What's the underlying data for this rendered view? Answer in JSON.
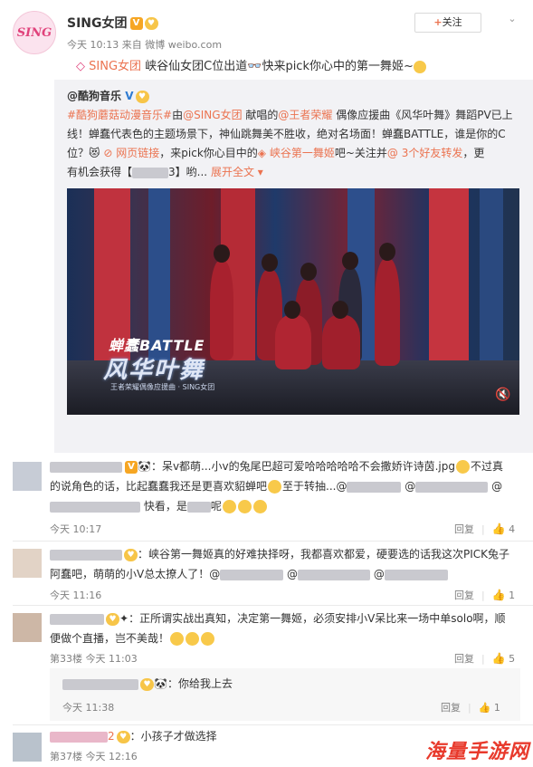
{
  "post": {
    "avatar_text": "SING",
    "username": "SING女团",
    "verified_badge": "V",
    "time": "今天 10:13",
    "source_prefix": "来自",
    "source": "微博 weibo.com",
    "follow_label": "关注",
    "follow_plus": "+",
    "mention": "SING女团",
    "text": "峡谷仙女团C位出道",
    "text2": "快来pick你心中的第一舞姬~"
  },
  "repost": {
    "author": "@酷狗音乐",
    "author_badge": "V",
    "line1_tag": "#酷狗蘑菇动漫音乐#",
    "line1_b": "由",
    "line1_c": "@SING女团",
    "line1_d": " 献唱的",
    "line1_e": "@王者荣耀",
    "line1_f": " 偶像应援曲《风华叶舞》舞蹈PV已上",
    "line2": "线！蝉蠢代表色的主题场景下，神仙跳舞美不胜收，绝对名场面！蝉蠢BATTLE，谁是你的C",
    "line3_a": "位？",
    "line3_link": "网页链接",
    "line3_b": "，来pick你心目中的",
    "line3_tag": "峡谷第一舞姬",
    "line3_c": "吧~关注并",
    "line3_d": "@ 3个好友转发",
    "line3_e": "，更",
    "line4_a": "有机会获得【",
    "line4_b": "3】哟...",
    "line4_more": "展开全文",
    "video": {
      "title_en": "蝉蠢BATTLE",
      "title_cn": "风华叶舞",
      "subtitle": "王者荣耀偶像应援曲 · SING女团",
      "mute_icon": "speaker-muted"
    }
  },
  "comments": [
    {
      "text_a": "：呆v都萌...小v的兔尾巴超可爱哈哈哈哈哈不会撒娇许诗茵.jpg",
      "text_b": "不过真",
      "text_c": "的说角色的话，比起蠢蠢我还是更喜欢貂蝉吧",
      "text_d": "至于转抽...@",
      "text_e": "@",
      "text_f": "@",
      "text_g": "快看，是",
      "text_h": "呢",
      "time": "今天 10:17",
      "reply": "回复",
      "likes": "4"
    },
    {
      "text_a": "：峡谷第一舞姬真的好难抉择呀，我都喜欢都爱，硬要选的话我这次PICK兔子",
      "text_b": "阿蠢吧，萌萌的小V总太撩人了！@",
      "text_c": "@",
      "text_d": "@",
      "time": "今天 11:16",
      "reply": "回复",
      "likes": "1"
    },
    {
      "text_a": "：正所谓实战出真知，决定第一舞姬，必须安排小V呆比来一场中单solo啊，顺",
      "text_b": "便做个直播，岂不美哉！",
      "floor": "第33楼",
      "time": "今天 11:03",
      "reply": "回复",
      "likes": "5"
    },
    {
      "text": "：你给我上去",
      "time": "今天 11:38",
      "reply": "回复",
      "likes": "1"
    },
    {
      "name_suffix": "2",
      "text": "：小孩子才做选择",
      "floor": "第37楼",
      "time": "今天 12:16"
    }
  ],
  "watermark": "海量手游网"
}
